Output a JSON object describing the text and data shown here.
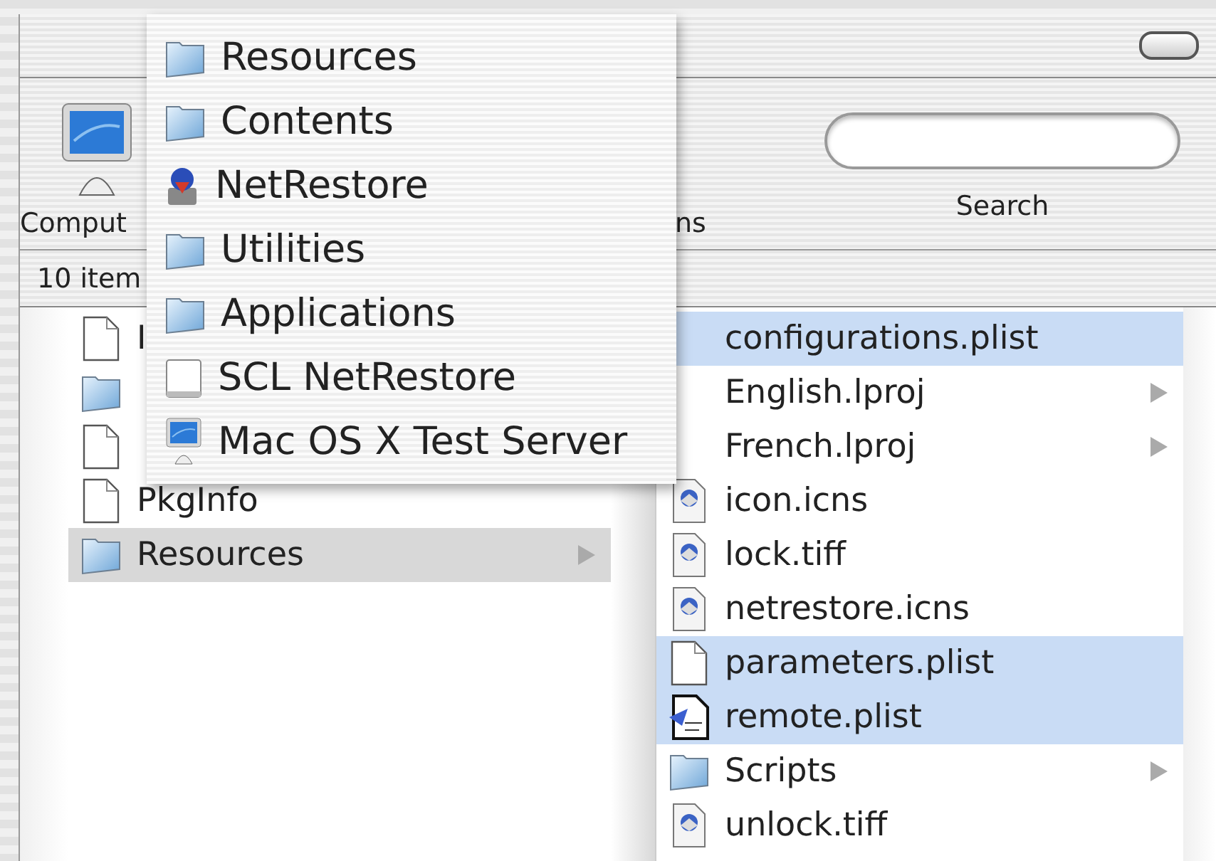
{
  "toolbar": {
    "computer_label": "Comput",
    "applications_label": "ns",
    "search": {
      "label": "Search"
    }
  },
  "status_bar": "10 item",
  "columns": [
    {
      "items": [
        {
          "name": "I",
          "kind": "document",
          "selected": false,
          "has_children": false
        },
        {
          "kind": "folder",
          "selected": false
        },
        {
          "kind": "document",
          "selected": false
        },
        {
          "name": "PkgInfo",
          "kind": "document",
          "selected": false,
          "has_children": false
        },
        {
          "name": "Resources",
          "kind": "folder",
          "selected": true,
          "has_children": true
        }
      ]
    },
    {
      "items": [
        {
          "name": "configurations.plist",
          "selected": true,
          "has_children": false
        },
        {
          "name": "English.lproj",
          "selected": false,
          "has_children": true
        },
        {
          "name": "French.lproj",
          "selected": false,
          "has_children": true
        },
        {
          "name": "icon.icns",
          "kind": "image",
          "selected": false,
          "has_children": false
        },
        {
          "name": "lock.tiff",
          "kind": "image",
          "selected": false,
          "has_children": false
        },
        {
          "name": "netrestore.icns",
          "kind": "image",
          "selected": false,
          "has_children": false
        },
        {
          "name": "parameters.plist",
          "kind": "document",
          "selected": true,
          "has_children": false
        },
        {
          "name": "remote.plist",
          "kind": "script",
          "selected": true,
          "has_children": false
        },
        {
          "name": "Scripts",
          "kind": "folder",
          "selected": false,
          "has_children": true
        },
        {
          "name": "unlock.tiff",
          "kind": "image",
          "selected": false,
          "has_children": false
        }
      ]
    }
  ],
  "path_menu": [
    {
      "label": "Resources",
      "kind": "folder"
    },
    {
      "label": "Contents",
      "kind": "folder"
    },
    {
      "label": "NetRestore",
      "kind": "app"
    },
    {
      "label": "Utilities",
      "kind": "folder"
    },
    {
      "label": "Applications",
      "kind": "folder"
    },
    {
      "label": "SCL NetRestore",
      "kind": "disk"
    },
    {
      "label": "Mac OS X Test Server",
      "kind": "computer"
    }
  ]
}
